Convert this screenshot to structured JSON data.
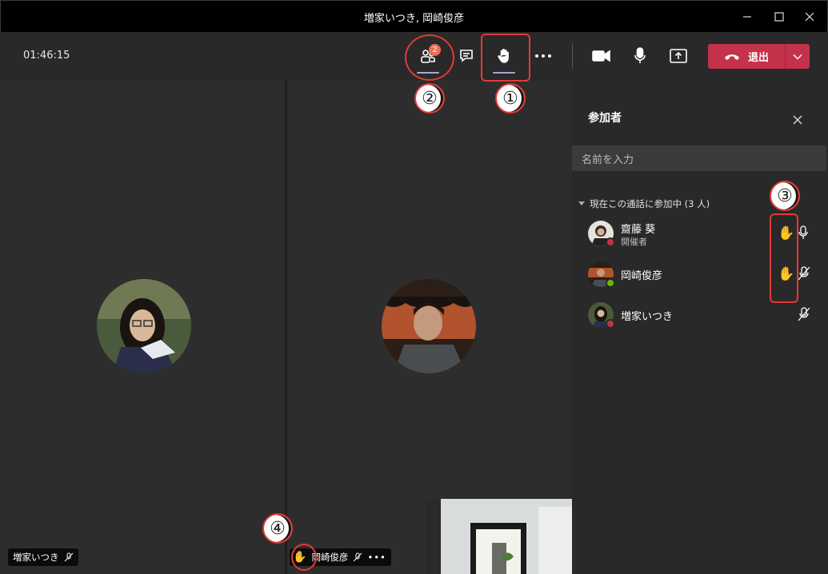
{
  "window": {
    "title": "増家いつき, 岡崎俊彦"
  },
  "toolbar": {
    "timer": "01:46:15",
    "participants_badge": "2",
    "leave_label": "退出"
  },
  "stage": {
    "tile_left_name": "増家いつき",
    "tile_bottom_name": "岡崎俊彦"
  },
  "panel": {
    "title": "参加者",
    "search_placeholder": "名前を入力",
    "section_label": "現在この通話に参加中 (3 人)",
    "participants": [
      {
        "name": "齋藤 葵",
        "role": "開催者",
        "hand_raised": true,
        "mic": "on",
        "status_color": "#c4314b"
      },
      {
        "name": "岡崎俊彦",
        "role": "",
        "hand_raised": true,
        "mic": "muted",
        "status_color": "#6bb700"
      },
      {
        "name": "増家いつき",
        "role": "",
        "hand_raised": false,
        "mic": "muted",
        "status_color": "#c4314b"
      }
    ]
  },
  "annotations": [
    "①",
    "②",
    "③",
    "④"
  ],
  "colors": {
    "accent": "#a6a7dc",
    "leave": "#c4314b",
    "annotation": "#e53935",
    "hand": "#f2b900"
  }
}
